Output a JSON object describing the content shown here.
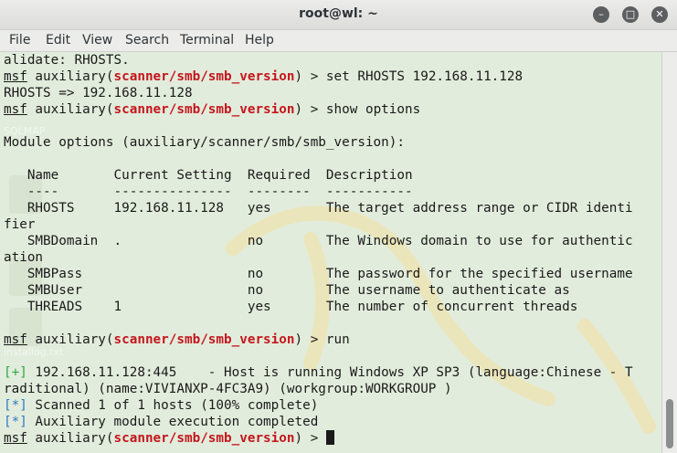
{
  "window": {
    "title": "root@wl: ~",
    "minimize_glyph": "–",
    "maximize_glyph": "□",
    "close_glyph": "✕"
  },
  "menu": [
    "File",
    "Edit",
    "View",
    "Search",
    "Terminal",
    "Help"
  ],
  "wallpaper": {
    "labels": [
      "SQLMAP",
      "installog.txt"
    ],
    "colors": {
      "terminal_bg": "#e2ecdc",
      "prompt_module": "#c4161c",
      "ok_marker": "#2aa845",
      "info_marker": "#2d79c3"
    }
  },
  "terminal": {
    "lines": [
      [
        {
          "t": "alidate: RHOSTS."
        }
      ],
      [
        {
          "t": "msf",
          "c": "msf"
        },
        {
          "t": " auxiliary("
        },
        {
          "t": "scanner/smb/smb_version",
          "c": "mod"
        },
        {
          "t": ") > set RHOSTS 192.168.11.128"
        }
      ],
      [
        {
          "t": "RHOSTS => 192.168.11.128"
        }
      ],
      [
        {
          "t": "msf",
          "c": "msf"
        },
        {
          "t": " auxiliary("
        },
        {
          "t": "scanner/smb/smb_version",
          "c": "mod"
        },
        {
          "t": ") > show options"
        }
      ],
      [
        {
          "t": ""
        }
      ],
      [
        {
          "t": "Module options (auxiliary/scanner/smb/smb_version):"
        }
      ],
      [
        {
          "t": ""
        }
      ],
      [
        {
          "t": "   Name       Current Setting  Required  Description"
        }
      ],
      [
        {
          "t": "   ----       ---------------  --------  -----------"
        }
      ],
      [
        {
          "t": "   RHOSTS     192.168.11.128   yes       The target address range or CIDR identi"
        }
      ],
      [
        {
          "t": "fier"
        }
      ],
      [
        {
          "t": "   SMBDomain  .                no        The Windows domain to use for authentic"
        }
      ],
      [
        {
          "t": "ation"
        }
      ],
      [
        {
          "t": "   SMBPass                     no        The password for the specified username"
        }
      ],
      [
        {
          "t": "   SMBUser                     no        The username to authenticate as"
        }
      ],
      [
        {
          "t": "   THREADS    1                yes       The number of concurrent threads"
        }
      ],
      [
        {
          "t": ""
        }
      ],
      [
        {
          "t": "msf",
          "c": "msf"
        },
        {
          "t": " auxiliary("
        },
        {
          "t": "scanner/smb/smb_version",
          "c": "mod"
        },
        {
          "t": ") > run"
        }
      ],
      [
        {
          "t": ""
        }
      ],
      [
        {
          "t": "[+]",
          "c": "plus"
        },
        {
          "t": " 192.168.11.128:445    - Host is running Windows XP SP3 (language:Chinese - T"
        }
      ],
      [
        {
          "t": "raditional) (name:VIVIANXP-4FC3A9) (workgroup:WORKGROUP )"
        }
      ],
      [
        {
          "t": "[*]",
          "c": "star"
        },
        {
          "t": " Scanned 1 of 1 hosts (100% complete)"
        }
      ],
      [
        {
          "t": "[*]",
          "c": "star"
        },
        {
          "t": " Auxiliary module execution completed"
        }
      ],
      [
        {
          "t": "msf",
          "c": "msf"
        },
        {
          "t": " auxiliary("
        },
        {
          "t": "scanner/smb/smb_version",
          "c": "mod"
        },
        {
          "t": ") > "
        }
      ]
    ]
  }
}
